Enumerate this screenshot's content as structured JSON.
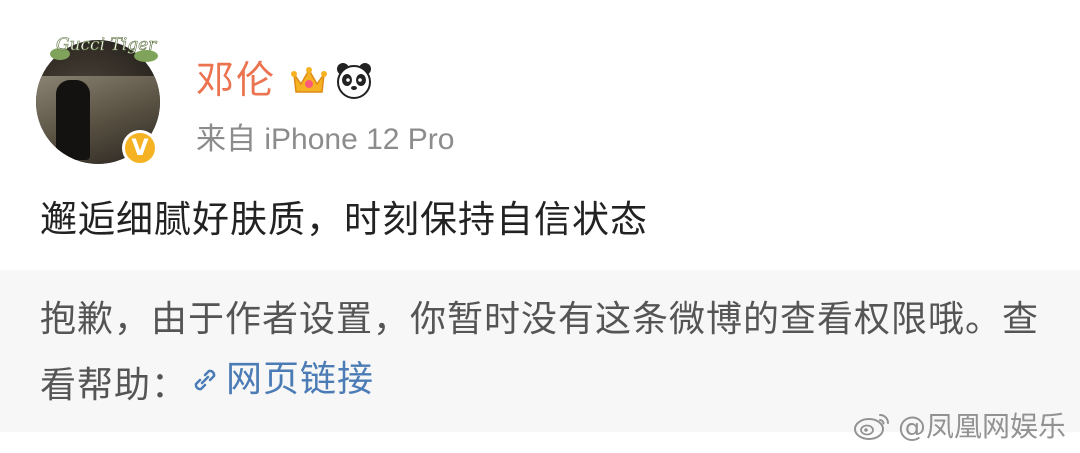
{
  "post": {
    "username": "邓伦",
    "source": "来自 iPhone 12 Pro",
    "content": "邂逅细腻好肤质，时刻保持自信状态",
    "avatar_text": "Gucci Tiger",
    "badges": [
      "crown-icon",
      "panda-icon"
    ],
    "vip_badge": "V"
  },
  "notice": {
    "text_part1": "抱歉，由于作者设置，你暂时没有这条微博的查看权限哦。查看帮助：",
    "link_label": "网页链接"
  },
  "watermark": {
    "text": "@凤凰网娱乐"
  },
  "colors": {
    "username": "#eb7350",
    "link": "#4b7cb5",
    "notice_bg": "#f7f7f7",
    "vip": "#f5b324"
  }
}
